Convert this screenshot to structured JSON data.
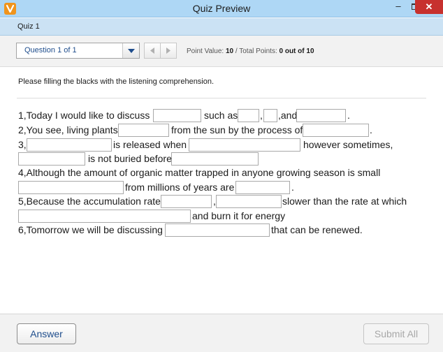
{
  "window": {
    "title": "Quiz Preview",
    "minimize_glyph": "–",
    "close_glyph": "✕"
  },
  "quiz_header": {
    "name": "Quiz 1"
  },
  "toolbar": {
    "question_selector": "Question 1 of 1",
    "point_value_label": "Point Value: ",
    "point_value": "10",
    "total_points_label": " / Total Points: ",
    "total_points": "0 out of 10"
  },
  "content": {
    "instructions": "Please filling the blacks with the listening comprehension.",
    "lines": {
      "l1_a": "1,Today I would like to discuss",
      "l1_b": "such as",
      "l1_c": ",",
      "l1_d": ",and",
      "l1_e": ".",
      "l2_a": "2,You see, living plants",
      "l2_b": "from the sun by the process of",
      "l2_c": ".",
      "l3_a": "3,",
      "l3_b": "is released when",
      "l3_c": "however sometimes,",
      "l3_d": "is not buried before",
      "l4_a": "4,Although the amount of organic matter trapped in anyone growing season is small",
      "l4_b": "from millions of years are",
      "l4_c": ".",
      "l5_a": "5,Because the accumulation rate",
      "l5_b": ",",
      "l5_c": "slower than the rate at which",
      "l5_d": "and burn it for energy",
      "l6_a": "6,Tomorrow we will be discussing",
      "l6_b": "that can be renewed."
    },
    "blanks": [
      "",
      "",
      "",
      "",
      "",
      "",
      "",
      "",
      "",
      "",
      "",
      "",
      "",
      "",
      "",
      ""
    ]
  },
  "footer": {
    "answer_label": "Answer",
    "submit_label": "Submit All"
  },
  "icons": {
    "app": "app-logo-icon",
    "dropdown": "chevron-down-icon",
    "prev": "triangle-left-icon",
    "next": "triangle-right-icon"
  },
  "colors": {
    "titlebar": "#aed7f5",
    "close": "#c7312e",
    "accent_text": "#1e4d8c",
    "app_icon": "#f0941c"
  }
}
